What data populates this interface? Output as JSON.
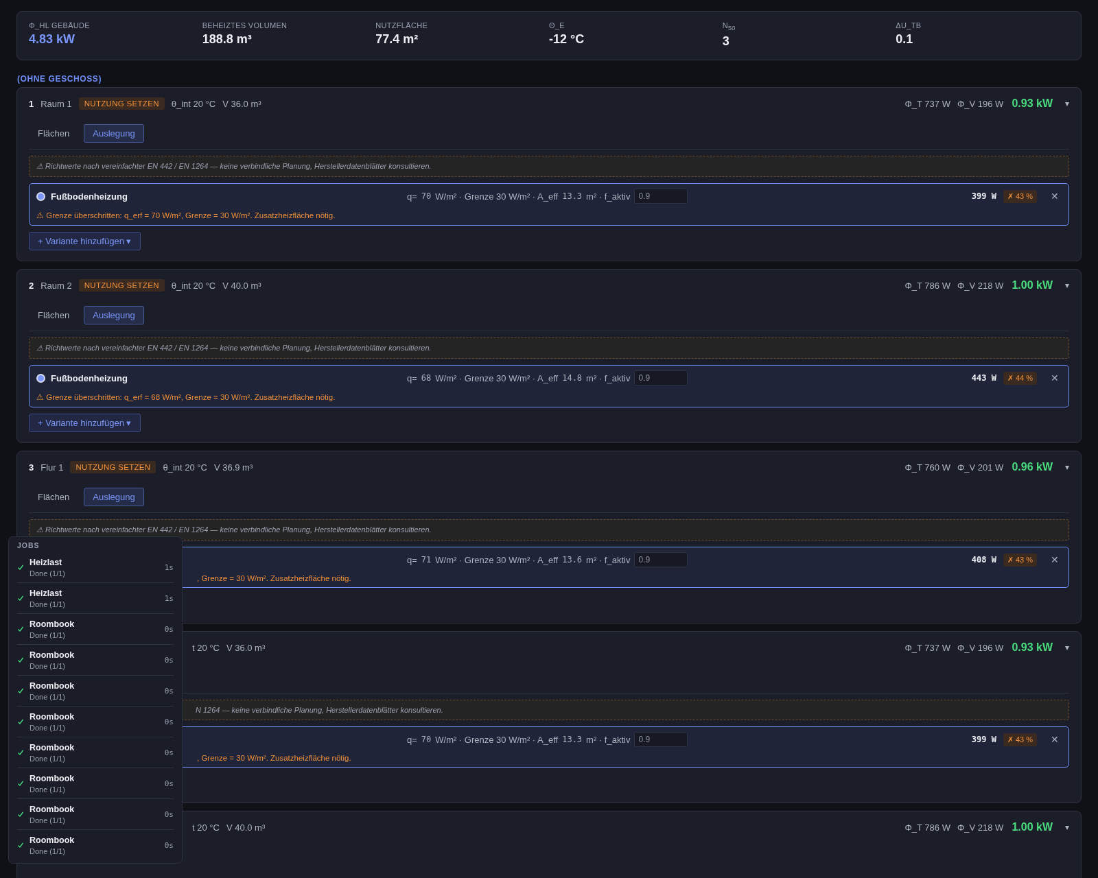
{
  "summary": [
    {
      "label": "Φ_HL GEBÄUDE",
      "value": "4.83 kW",
      "accent": true
    },
    {
      "label": "BEHEIZTES VOLUMEN",
      "value": "188.8 m³",
      "accent": false
    },
    {
      "label": "NUTZFLÄCHE",
      "value": "77.4 m²",
      "accent": false
    },
    {
      "label": "Θ_E",
      "value": "-12 °C",
      "accent": false
    },
    {
      "label": "N$_{50}$",
      "value": "3",
      "accent": false
    },
    {
      "label": "ΔU_TB",
      "value": "0.1",
      "accent": false
    }
  ],
  "section": "(OHNE GESCHOSS)",
  "rooms": [
    {
      "number": "1",
      "name": "Raum 1",
      "usage": "NUTZUNG SETZEN",
      "temp": "θ_int 20 °C",
      "volume": "V 36.0 m³",
      "phi_t": "Φ_T 737 W",
      "phi_v": "Φ_V 196 W",
      "total": "0.93 kW",
      "caret": "▾",
      "tabs": [
        {
          "label": "Flächen",
          "selected": false
        },
        {
          "label": "Auslegung",
          "selected": true
        }
      ],
      "info": "⚠ Richtwerte nach vereinfachter EN 442 / EN 1264 — keine verbindliche Planung, Herstellerdatenblätter konsultieren.",
      "variants": [
        {
          "title": "Fußbodenheizung",
          "selected": true,
          "q_label": "q=",
          "q": "70",
          "q_unit": "W/m² · Grenze 30 W/m² · A_eff",
          "a_eff": "13.3",
          "a_unit": "m² · f_aktiv",
          "f_aktiv": "0.9",
          "power": "399 W",
          "badge": "✗ 43 %",
          "close": "✕",
          "warning": "⚠ Grenze überschritten: q_erf = 70 W/m², Grenze = 30 W/m². Zusatzheizfläche nötig."
        }
      ],
      "add_button": "+ Variante hinzufügen ▾"
    },
    {
      "number": "2",
      "name": "Raum 2",
      "usage": "NUTZUNG SETZEN",
      "temp": "θ_int 20 °C",
      "volume": "V 40.0 m³",
      "phi_t": "Φ_T 786 W",
      "phi_v": "Φ_V 218 W",
      "total": "1.00 kW",
      "caret": "▾",
      "tabs": [
        {
          "label": "Flächen",
          "selected": false
        },
        {
          "label": "Auslegung",
          "selected": true
        }
      ],
      "info": "⚠ Richtwerte nach vereinfachter EN 442 / EN 1264 — keine verbindliche Planung, Herstellerdatenblätter konsultieren.",
      "variants": [
        {
          "title": "Fußbodenheizung",
          "selected": true,
          "q_label": "q=",
          "q": "68",
          "q_unit": "W/m² · Grenze 30 W/m² · A_eff",
          "a_eff": "14.8",
          "a_unit": "m² · f_aktiv",
          "f_aktiv": "0.9",
          "power": "443 W",
          "badge": "✗ 44 %",
          "close": "✕",
          "warning": "⚠ Grenze überschritten: q_erf = 68 W/m², Grenze = 30 W/m². Zusatzheizfläche nötig."
        }
      ],
      "add_button": "+ Variante hinzufügen ▾"
    },
    {
      "number": "3",
      "name": "Flur 1",
      "usage": "NUTZUNG SETZEN",
      "temp": "θ_int 20 °C",
      "volume": "V 36.9 m³",
      "phi_t": "Φ_T 760 W",
      "phi_v": "Φ_V 201 W",
      "total": "0.96 kW",
      "caret": "▾",
      "tabs": [
        {
          "label": "Flächen",
          "selected": false
        },
        {
          "label": "Auslegung",
          "selected": true
        }
      ],
      "info": "⚠ Richtwerte nach vereinfachter EN 442 / EN 1264 — keine verbindliche Planung, Herstellerdatenblätter konsultieren.",
      "variants": [
        {
          "q_label": "q=",
          "q": "71",
          "q_unit": "W/m² · Grenze 30 W/m² · A_eff",
          "a_eff": "13.6",
          "a_unit": "m² · f_aktiv",
          "f_aktiv": "0.9",
          "power": "408 W",
          "badge": "✗ 43 %",
          "close": "✕",
          "warning": ", Grenze = 30 W/m². Zusatzheizfläche nötig."
        }
      ]
    },
    {
      "temp": "t 20 °C",
      "volume": "V 36.0 m³",
      "phi_t": "Φ_T 737 W",
      "phi_v": "Φ_V 196 W",
      "total": "0.93 kW",
      "caret": "▾",
      "info": "N 1264 — keine verbindliche Planung, Herstellerdatenblätter konsultieren.",
      "variants": [
        {
          "q_label": "q=",
          "q": "70",
          "q_unit": "W/m² · Grenze 30 W/m² · A_eff",
          "a_eff": "13.3",
          "a_unit": "m² · f_aktiv",
          "f_aktiv": "0.9",
          "power": "399 W",
          "badge": "✗ 43 %",
          "close": "✕",
          "warning": ", Grenze = 30 W/m². Zusatzheizfläche nötig."
        }
      ]
    },
    {
      "temp": "t 20 °C",
      "volume": "V 40.0 m³",
      "phi_t": "Φ_T 786 W",
      "phi_v": "Φ_V 218 W",
      "total": "1.00 kW",
      "caret": "▾"
    }
  ],
  "jobs": {
    "title": "JOBS",
    "items": [
      {
        "name": "Heizlast",
        "status": "Done (1/1)",
        "time": "1s"
      },
      {
        "name": "Heizlast",
        "status": "Done (1/1)",
        "time": "1s"
      },
      {
        "name": "Roombook",
        "status": "Done (1/1)",
        "time": "0s"
      },
      {
        "name": "Roombook",
        "status": "Done (1/1)",
        "time": "0s"
      },
      {
        "name": "Roombook",
        "status": "Done (1/1)",
        "time": "0s"
      },
      {
        "name": "Roombook",
        "status": "Done (1/1)",
        "time": "0s"
      },
      {
        "name": "Roombook",
        "status": "Done (1/1)",
        "time": "0s"
      },
      {
        "name": "Roombook",
        "status": "Done (1/1)",
        "time": "0s"
      },
      {
        "name": "Roombook",
        "status": "Done (1/1)",
        "time": "0s"
      },
      {
        "name": "Roombook",
        "status": "Done (1/1)",
        "time": "0s"
      }
    ]
  }
}
